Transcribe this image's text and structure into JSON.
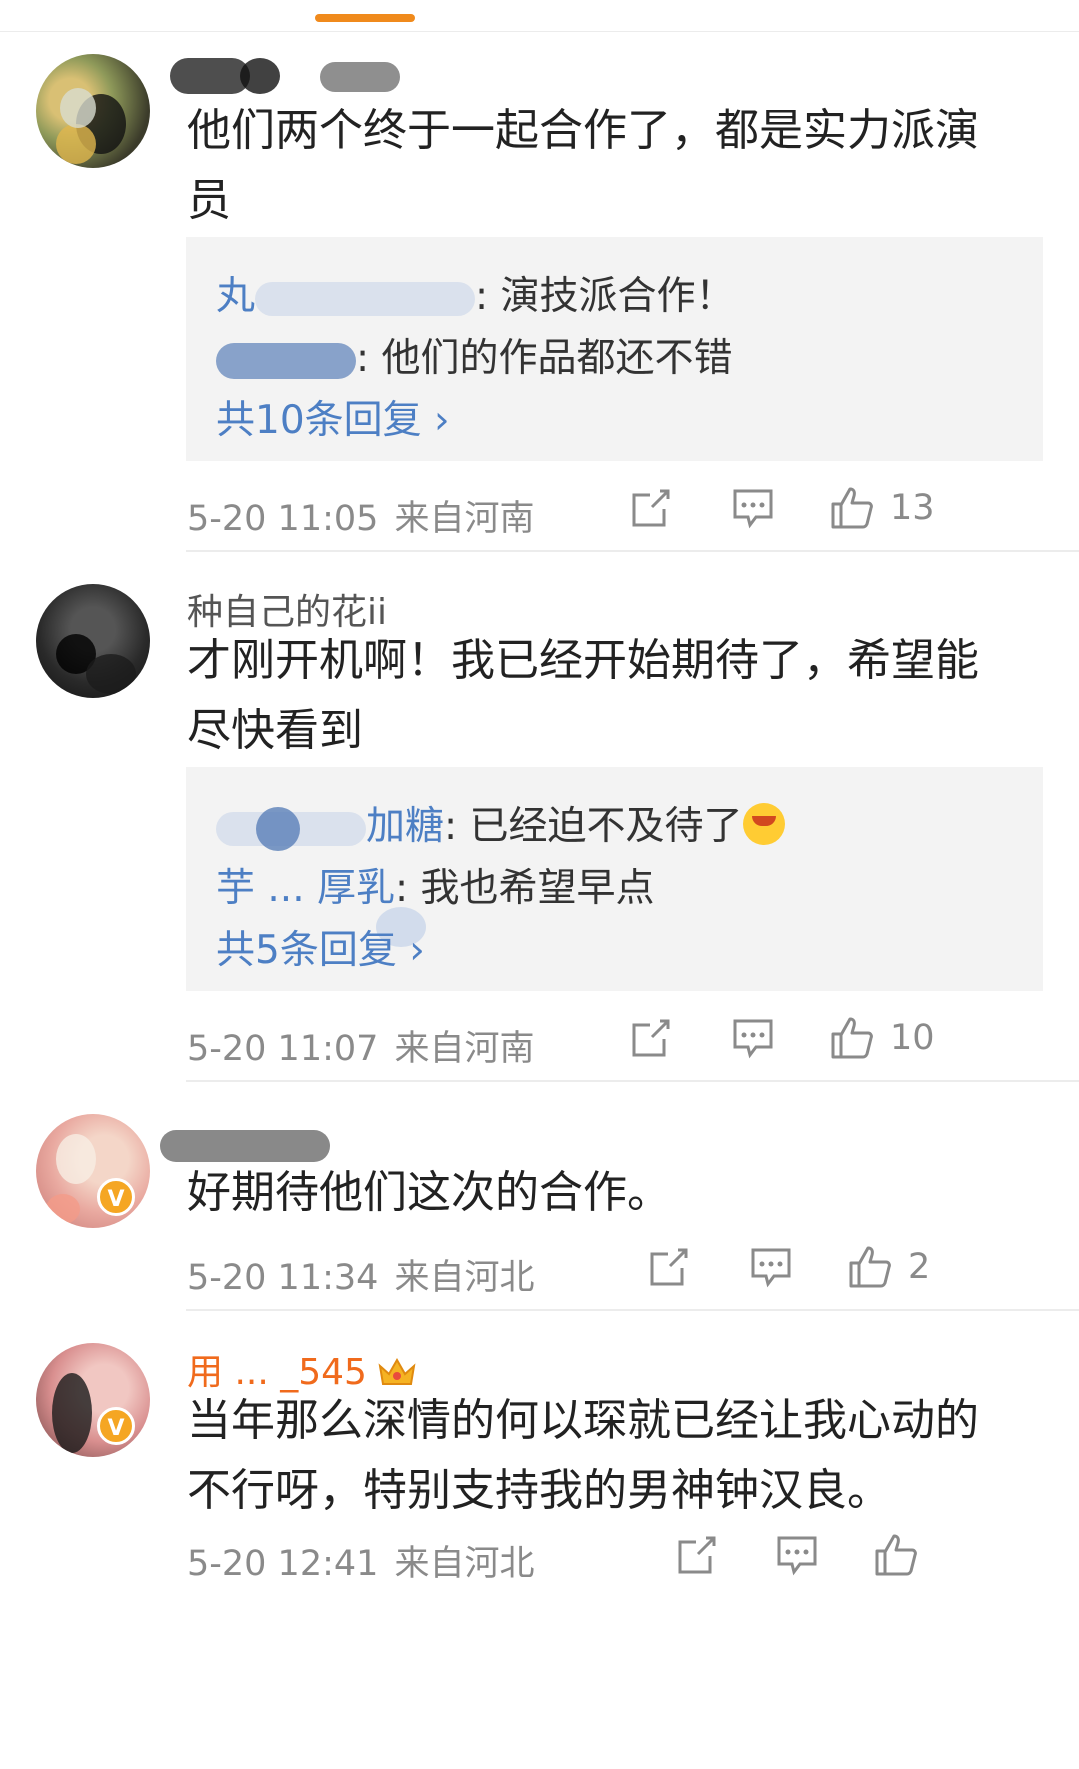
{
  "comments": [
    {
      "username": "",
      "text": "他们两个终于一起合作了，都是实力派演员",
      "replies": [
        {
          "name": "丸",
          "text": ": 演技派合作！"
        },
        {
          "name": "",
          "text": ": 他们的作品都还不错"
        }
      ],
      "more_replies": "共10条回复 ›",
      "date": "5-20 11:05",
      "source": "来自河南",
      "likes": "13"
    },
    {
      "username": "种自己的花ii",
      "text": "才刚开机啊！我已经开始期待了，希望能尽快看到",
      "replies": [
        {
          "name": "加糖",
          "text": ": 已经迫不及待了"
        },
        {
          "name": "芋 ... 厚乳",
          "text": ": 我也希望早点"
        }
      ],
      "more_replies": "共5条回复 ›",
      "date": "5-20 11:07",
      "source": "来自河南",
      "likes": "10"
    },
    {
      "username": "",
      "text": "好期待他们这次的合作。",
      "date": "5-20 11:34",
      "source": "来自河北",
      "likes": "2",
      "verified": "V"
    },
    {
      "username": "用 ... _545",
      "text": "当年那么深情的何以琛就已经让我心动的不行呀，特别支持我的男神钟汉良。",
      "date": "5-20 12:41",
      "source": "来自河北",
      "likes": "",
      "verified": "V"
    }
  ],
  "icons": {
    "repost": "share-icon",
    "comment": "comment-icon",
    "like": "thumbs-up-icon",
    "crown": "crown-icon"
  },
  "colors": {
    "accent": "#f08a1c",
    "link": "#4d7fc4",
    "username_vip": "#f06a1c",
    "meta": "#8a8a8a"
  }
}
